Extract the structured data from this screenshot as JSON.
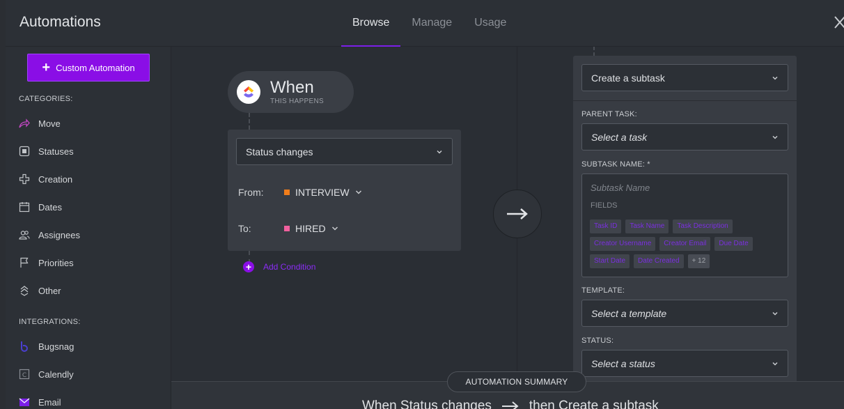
{
  "header": {
    "title": "Automations",
    "tabs": [
      {
        "label": "Browse",
        "active": true
      },
      {
        "label": "Manage",
        "active": false
      },
      {
        "label": "Usage",
        "active": false
      }
    ]
  },
  "sidebar": {
    "custom_button": "Custom Automation",
    "categories_label": "CATEGORIES:",
    "categories": [
      {
        "label": "Move",
        "icon": "move-arrow-icon"
      },
      {
        "label": "Statuses",
        "icon": "status-square-icon"
      },
      {
        "label": "Creation",
        "icon": "plus-outline-icon"
      },
      {
        "label": "Dates",
        "icon": "calendar-icon"
      },
      {
        "label": "Assignees",
        "icon": "people-icon"
      },
      {
        "label": "Priorities",
        "icon": "flag-icon"
      },
      {
        "label": "Other",
        "icon": "stack-icon"
      }
    ],
    "integrations_label": "INTEGRATIONS:",
    "integrations": [
      {
        "label": "Bugsnag",
        "icon": "bugsnag-icon"
      },
      {
        "label": "Calendly",
        "icon": "calendly-icon"
      },
      {
        "label": "Email",
        "icon": "email-icon"
      }
    ]
  },
  "trigger": {
    "when_title": "When",
    "when_sub": "THIS HAPPENS",
    "event": "Status changes",
    "from_label": "From:",
    "from_value": "INTERVIEW",
    "from_color": "#f07d1b",
    "to_label": "To:",
    "to_value": "HIRED",
    "to_color": "#f0609e",
    "add_condition": "Add Condition"
  },
  "action": {
    "type": "Create a subtask",
    "parent_label": "PARENT TASK:",
    "parent_value": "Select a task",
    "subtask_label": "SUBTASK NAME: *",
    "subtask_placeholder": "Subtask Name",
    "fields_label": "FIELDS",
    "fields": [
      "Task ID",
      "Task Name",
      "Task Description",
      "Creator Username",
      "Creator Email",
      "Due Date",
      "Start Date",
      "Date Created"
    ],
    "fields_more": "+ 12",
    "template_label": "TEMPLATE:",
    "template_value": "Select a template",
    "status_label": "STATUS:",
    "status_value": "Select a status"
  },
  "summary": {
    "label": "AUTOMATION SUMMARY",
    "when_text": "When Status changes",
    "then_text": "then Create a subtask"
  },
  "colors": {
    "accent": "#8a0ee6"
  }
}
